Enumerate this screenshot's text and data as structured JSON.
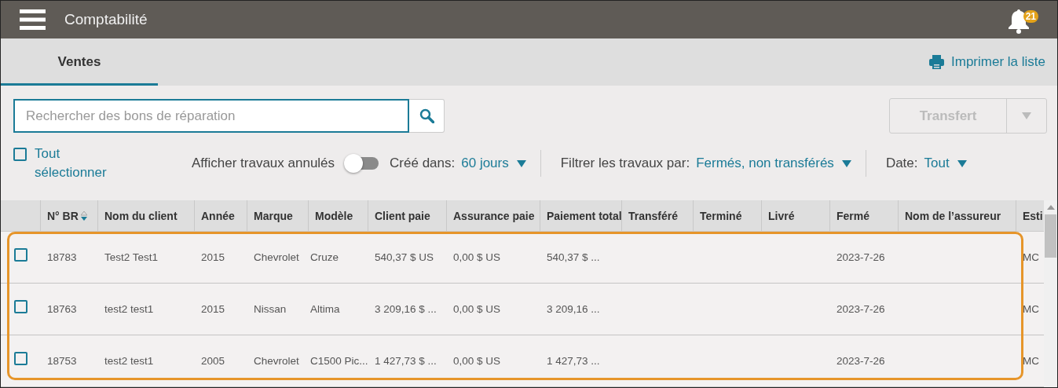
{
  "header": {
    "title": "Comptabilité",
    "notification_count": "21"
  },
  "tabs": [
    {
      "label": "Ventes",
      "selected": true
    }
  ],
  "print_link": "Imprimer la liste",
  "search": {
    "placeholder": "Rechercher des bons de réparation"
  },
  "transfer_button": {
    "label": "Transfert",
    "disabled": true
  },
  "select_all": {
    "label": "Tout sélectionner",
    "checked": false
  },
  "cancelled_toggle": {
    "label": "Afficher travaux annulés",
    "on": false
  },
  "filters": [
    {
      "label": "Créé dans:",
      "value": "60 jours"
    },
    {
      "label": "Filtrer les travaux par:",
      "value": "Fermés, non transférés"
    },
    {
      "label": "Date:",
      "value": "Tout"
    }
  ],
  "table": {
    "columns": [
      {
        "label": "N° BR",
        "sortable": true
      },
      {
        "label": "Nom du client"
      },
      {
        "label": "Année"
      },
      {
        "label": "Marque"
      },
      {
        "label": "Modèle"
      },
      {
        "label": "Client paie"
      },
      {
        "label": "Assurance paie"
      },
      {
        "label": "Paiement total"
      },
      {
        "label": "Transféré"
      },
      {
        "label": "Terminé"
      },
      {
        "label": "Livré"
      },
      {
        "label": "Fermé"
      },
      {
        "label": "Nom de l’assureur"
      },
      {
        "label": "Esti"
      }
    ],
    "rows": [
      {
        "checked": false,
        "cells": [
          "18783",
          "Test2 Test1",
          "2015",
          "Chevrolet",
          "Cruze",
          "540,37 $ US",
          "0,00 $ US",
          "540,37 $ ...",
          null,
          null,
          null,
          "2023-7-26",
          null,
          "MC"
        ]
      },
      {
        "checked": false,
        "cells": [
          "18763",
          "test2 test1",
          "2015",
          "Nissan",
          "Altima",
          "3 209,16 $ ...",
          "0,00 $ US",
          "3 209,16 ...",
          null,
          null,
          null,
          "2023-7-26",
          null,
          "MC"
        ]
      },
      {
        "checked": false,
        "cells": [
          "18753",
          "test2 test1",
          "2005",
          "Chevrolet",
          "C1500 Pic...",
          "1 427,73 $ ...",
          "0,00 $ US",
          "1 427,73 ...",
          null,
          null,
          null,
          "2023-7-26",
          null,
          "MC"
        ]
      }
    ]
  }
}
